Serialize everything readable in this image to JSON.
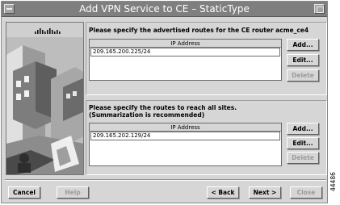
{
  "window": {
    "title": "Add VPN Service to CE – StaticType"
  },
  "advertised": {
    "label": "Please specify the advertised routes for the CE router acme_ce4",
    "column_header": "IP Address",
    "rows": [
      "209.165.200.225/24"
    ],
    "buttons": {
      "add": "Add...",
      "edit": "Edit...",
      "delete": "Delete"
    }
  },
  "reach": {
    "label_line1": "Please specify the routes to reach all sites.",
    "label_line2": "(Summarization is recommended)",
    "column_header": "IP Address",
    "rows": [
      "209.165.202.129/24"
    ],
    "buttons": {
      "add": "Add...",
      "edit": "Edit...",
      "delete": "Delete"
    }
  },
  "footer": {
    "cancel": "Cancel",
    "help": "Help",
    "back": "< Back",
    "next": "Next >",
    "close": "Close"
  },
  "figure_number": "44486",
  "colors": {
    "titlebar": "#7f7f7f",
    "dialog": "#d6d6d6",
    "disabled_text": "#9c9c9c"
  }
}
